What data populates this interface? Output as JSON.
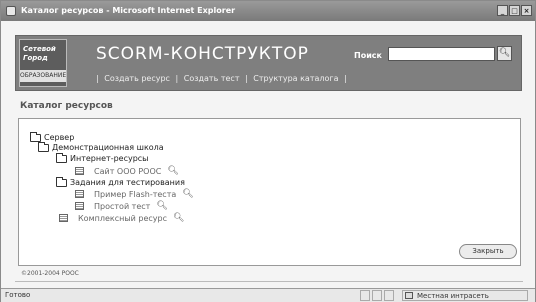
{
  "window": {
    "title": "Каталог ресурсов - Microsoft Internet Explorer",
    "controls": [
      "_",
      "□",
      "×"
    ]
  },
  "header": {
    "logo_line1": "Сетевой",
    "logo_line2": "Город",
    "logo_line3": "ОБРАЗОВАНИЕ",
    "brand": "SCORM-КОНСТРУКТОР",
    "search_label": "Поиск",
    "search_value": "",
    "search_icon": "magnifier-icon",
    "menu": [
      "|",
      "Создать ресурс",
      "|",
      "Создать тест",
      "|",
      "Структура каталога",
      "|"
    ]
  },
  "main": {
    "section_title": "Каталог ресурсов",
    "tree": [
      {
        "label": "Сервер",
        "type": "folder"
      },
      {
        "label": "Демонстрационная школа",
        "type": "folder"
      },
      {
        "label": "Интернет-ресурсы",
        "type": "folder"
      },
      {
        "label": "Сайт ООО РООС",
        "type": "resource"
      },
      {
        "label": "Задания для тестирования",
        "type": "folder"
      },
      {
        "label": "Пример Flash-теста",
        "type": "resource"
      },
      {
        "label": "Простой тест",
        "type": "resource"
      },
      {
        "label": "Комплексный ресурс",
        "type": "resource"
      }
    ],
    "close_button": "Закрыть"
  },
  "footer": {
    "copyright": "©2001-2004 РООС"
  },
  "statusbar": {
    "status": "Готово",
    "zone": "Местная интрасеть"
  }
}
